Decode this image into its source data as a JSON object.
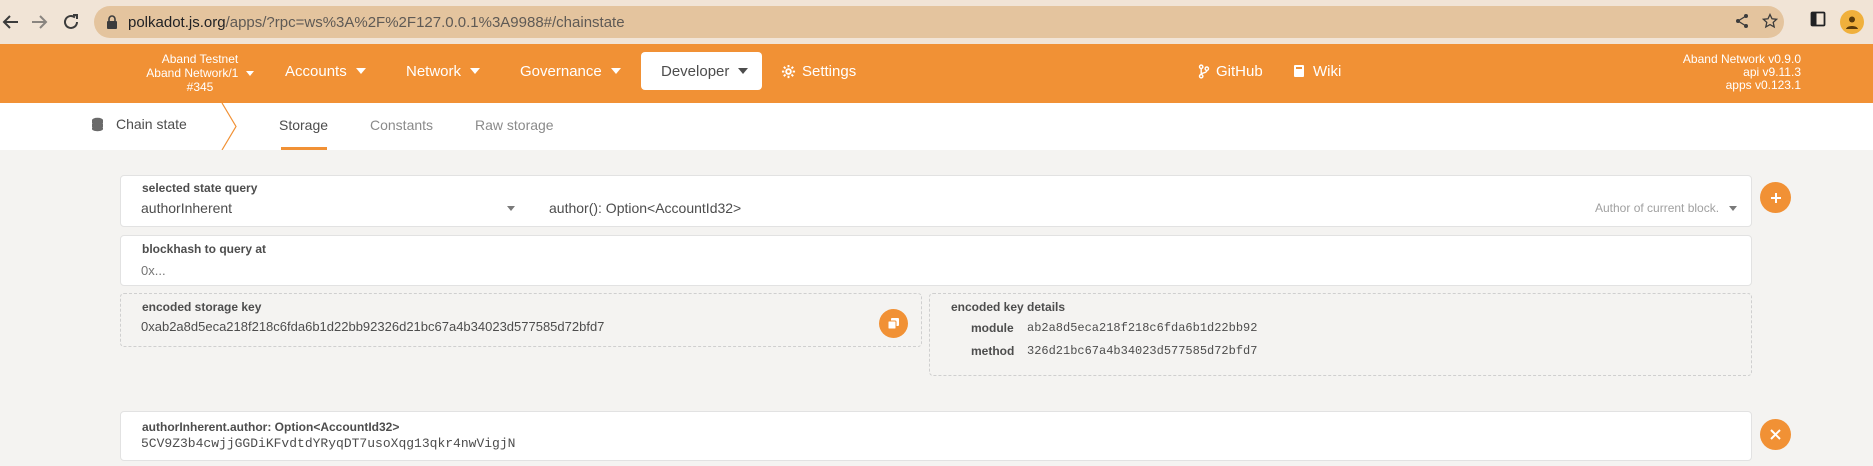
{
  "browser": {
    "url_host": "polkadot.js.org",
    "url_path": "/apps/?rpc=ws%3A%2F%2F127.0.0.1%3A9988#/chainstate"
  },
  "header": {
    "chain_name": "Aband Testnet",
    "chain_network": "Aband Network/1",
    "chain_block": "#345",
    "menus": [
      {
        "label": "Accounts"
      },
      {
        "label": "Network"
      },
      {
        "label": "Governance"
      },
      {
        "label": "Developer"
      }
    ],
    "settings_label": "Settings",
    "github_label": "GitHub",
    "wiki_label": "Wiki",
    "version_network": "Aband Network v0.9.0",
    "version_api": "api v9.11.3",
    "version_apps": "apps v0.123.1"
  },
  "subnav": {
    "section_label": "Chain state",
    "tabs": [
      {
        "label": "Storage"
      },
      {
        "label": "Constants"
      },
      {
        "label": "Raw storage"
      }
    ]
  },
  "query": {
    "label": "selected state query",
    "module": "authorInherent",
    "method_signature": "author(): Option<AccountId32>",
    "method_doc": "Author of current block."
  },
  "blockhash": {
    "label": "blockhash to query at",
    "placeholder": "0x..."
  },
  "storage_key": {
    "label": "encoded storage key",
    "value": "0xab2a8d5eca218f218c6fda6b1d22bb92326d21bc67a4b34023d577585d72bfd7"
  },
  "key_details": {
    "label": "encoded key details",
    "module_label": "module",
    "module_value": "ab2a8d5eca218f218c6fda6b1d22bb92",
    "method_label": "method",
    "method_value": "326d21bc67a4b34023d577585d72bfd7"
  },
  "result": {
    "label": "authorInherent.author: Option<AccountId32>",
    "value": "5CV9Z3b4cwjjGGDiKFvdtdYRyqDT7usoXqg13qkr4nwVigjN"
  },
  "colors": {
    "accent": "#f19135",
    "browser_bar": "#f1e4d6",
    "url_bar": "#e4c49e",
    "page_bg": "#f4f3f1"
  },
  "icons": {
    "back": "arrow-left-icon",
    "forward": "arrow-right-icon",
    "reload": "reload-icon",
    "lock": "lock-icon",
    "share": "share-icon",
    "bookmark": "star-icon",
    "sidepanel": "sidepanel-icon",
    "profile": "profile-icon",
    "settings": "gear-icon",
    "github": "code-branch-icon",
    "wiki": "book-icon",
    "chainstate": "database-icon",
    "add": "plus-icon",
    "copy": "copy-icon",
    "close": "close-icon"
  }
}
